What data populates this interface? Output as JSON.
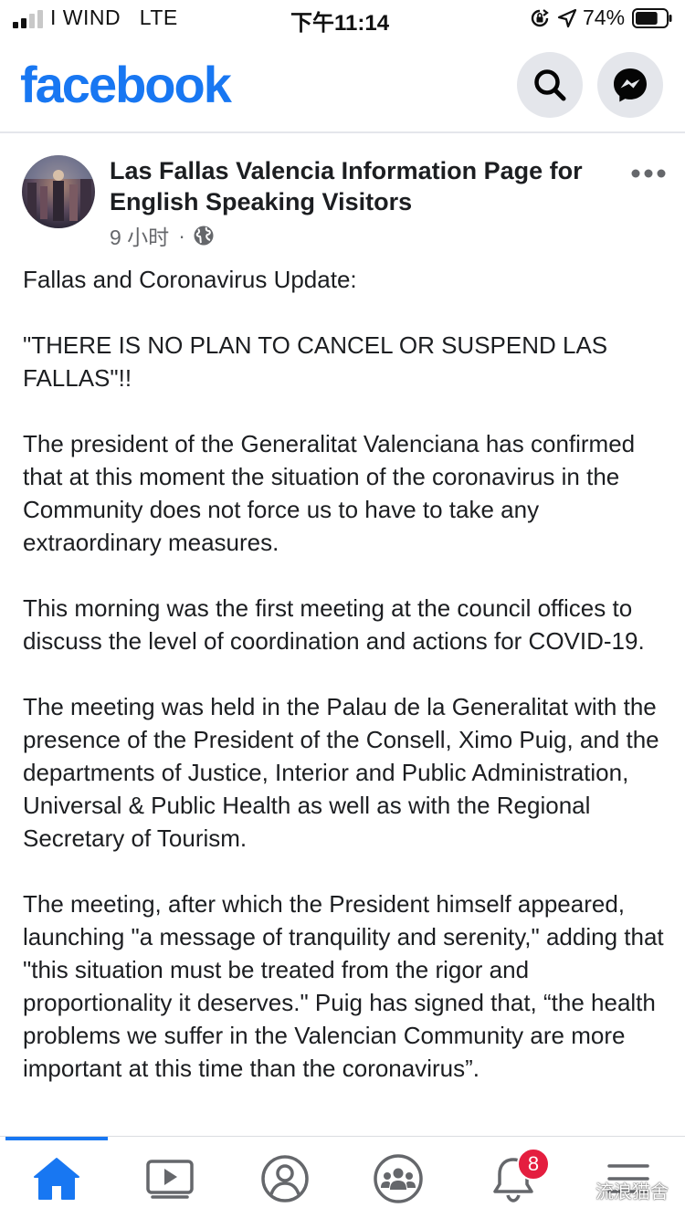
{
  "status_bar": {
    "carrier": "I WIND",
    "network": "LTE",
    "time": "下午11:14",
    "battery_percent": "74%",
    "battery_level": 0.74
  },
  "header": {
    "logo": "facebook",
    "brand_color": "#1877f2",
    "search_icon": "search-icon",
    "messenger_icon": "messenger-icon"
  },
  "post": {
    "author": "Las Fallas Valencia Information Page for English Speaking Visitors",
    "time_ago": "9 小时",
    "separator": "·",
    "privacy_icon": "globe-icon",
    "paragraphs": [
      "Fallas and Coronavirus Update:",
      "\"THERE IS NO PLAN TO CANCEL OR SUSPEND LAS FALLAS\"!!",
      "The president of the Generalitat Valenciana has confirmed that at this moment the situation of the coronavirus in the Community does not force us to have to take any extraordinary measures.",
      "This morning was the first meeting at the council offices to discuss the level of coordination and actions for COVID-19.",
      "The meeting was held in the Palau de la Generalitat with the presence of the President of the Consell, Ximo Puig, and the departments of Justice, Interior and Public Administration, Universal & Public Health as well as with the Regional Secretary of Tourism.",
      "The meeting, after which the President himself appeared, launching \"a message of tranquility and serenity,\" adding that \"this situation must be treated from the rigor and proportionality it deserves.\"  Puig has signed that, “the health problems we suffer in the Valencian Community are more important at this time than the coronavirus”."
    ]
  },
  "bottom_nav": {
    "items": [
      "home-icon",
      "watch-icon",
      "profile-icon",
      "groups-icon",
      "notifications-icon",
      "menu-icon"
    ],
    "active": "home-icon",
    "notifications_badge": "8",
    "badge_color": "#e41e3f"
  },
  "watermark": {
    "text": "流浪猫舍"
  }
}
